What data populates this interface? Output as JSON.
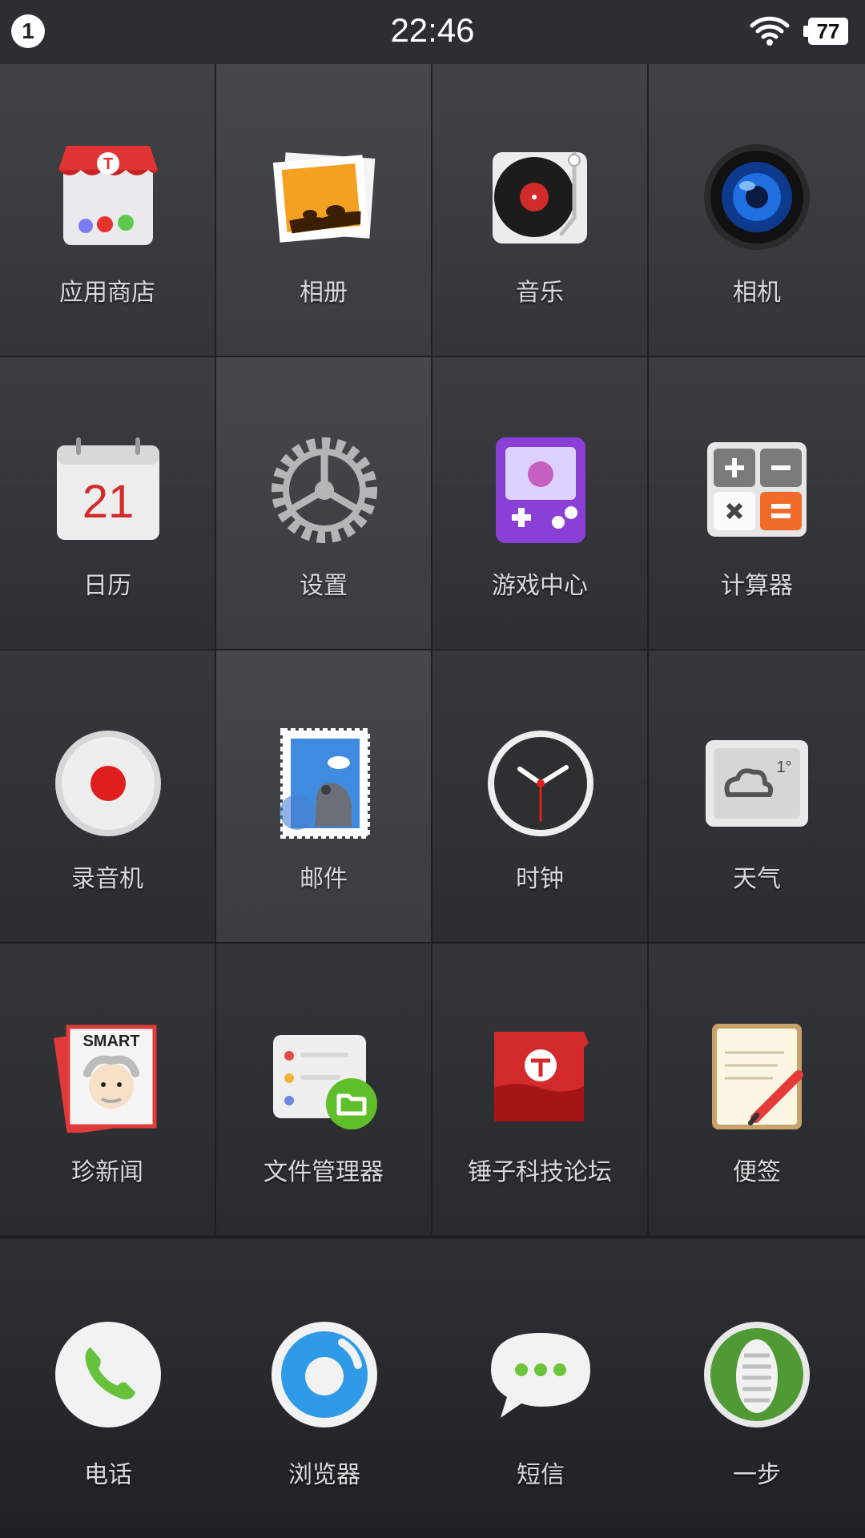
{
  "status_bar": {
    "notification_count": "1",
    "time": "22:46",
    "battery": "77"
  },
  "apps": [
    {
      "label": "应用商店",
      "icon": "app-store-icon"
    },
    {
      "label": "相册",
      "icon": "photo-album-icon"
    },
    {
      "label": "音乐",
      "icon": "music-turntable-icon"
    },
    {
      "label": "相机",
      "icon": "camera-lens-icon"
    },
    {
      "label": "日历",
      "icon": "calendar-icon",
      "icon_text": "21"
    },
    {
      "label": "设置",
      "icon": "gear-icon"
    },
    {
      "label": "游戏中心",
      "icon": "game-console-icon"
    },
    {
      "label": "计算器",
      "icon": "calculator-icon"
    },
    {
      "label": "录音机",
      "icon": "recorder-icon"
    },
    {
      "label": "邮件",
      "icon": "mail-stamp-icon"
    },
    {
      "label": "时钟",
      "icon": "clock-icon"
    },
    {
      "label": "天气",
      "icon": "weather-icon",
      "icon_text": "1°"
    },
    {
      "label": "珍新闻",
      "icon": "smart-news-icon",
      "icon_text": "SMART"
    },
    {
      "label": "文件管理器",
      "icon": "file-manager-icon"
    },
    {
      "label": "锤子科技论坛",
      "icon": "forum-icon"
    },
    {
      "label": "便签",
      "icon": "notes-icon"
    }
  ],
  "dock": [
    {
      "label": "电话",
      "icon": "phone-icon"
    },
    {
      "label": "浏览器",
      "icon": "browser-icon"
    },
    {
      "label": "短信",
      "icon": "messages-icon"
    },
    {
      "label": "一步",
      "icon": "one-step-icon"
    }
  ],
  "colors": {
    "background": "#2e3034",
    "label": "#d9d9d9",
    "accent_red": "#e23b3b",
    "accent_green": "#7ac143",
    "accent_purple": "#8a3fd6"
  }
}
